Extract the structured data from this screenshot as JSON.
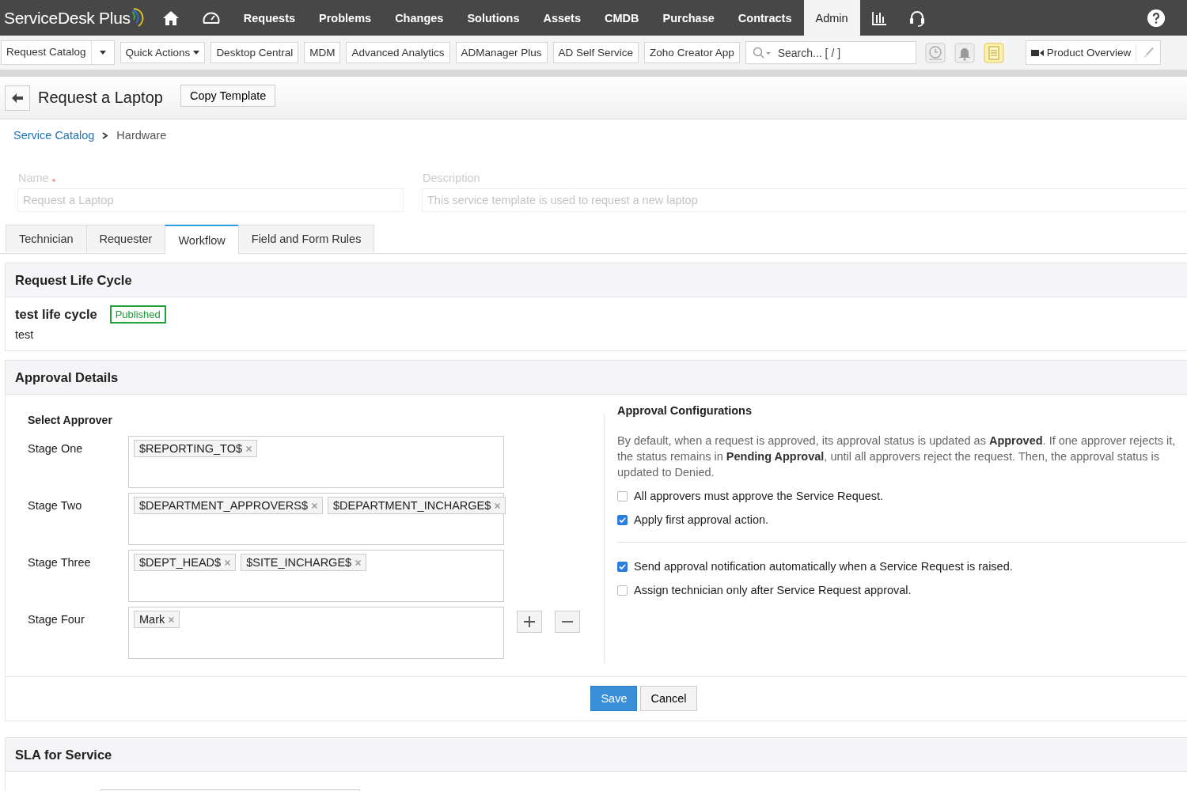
{
  "app": {
    "logo": "ServiceDesk Plus"
  },
  "nav": [
    {
      "kind": "icon",
      "selected": false
    },
    {
      "kind": "icon",
      "selected": false
    },
    {
      "kind": "text",
      "label": "Requests",
      "selected": false
    },
    {
      "kind": "text",
      "label": "Problems",
      "selected": false
    },
    {
      "kind": "text",
      "label": "Changes",
      "selected": false
    },
    {
      "kind": "text",
      "label": "Solutions",
      "selected": false
    },
    {
      "kind": "text",
      "label": "Assets",
      "selected": false
    },
    {
      "kind": "text",
      "label": "CMDB",
      "selected": false
    },
    {
      "kind": "text",
      "label": "Purchase",
      "selected": false
    },
    {
      "kind": "text",
      "label": "Contracts",
      "selected": false
    },
    {
      "kind": "text",
      "label": "Admin",
      "selected": true
    },
    {
      "kind": "icon",
      "selected": false
    },
    {
      "kind": "icon",
      "selected": false
    }
  ],
  "toolbar": [
    {
      "kind": "split",
      "label": "Request Catalog"
    },
    {
      "kind": "dropdown",
      "label": "Quick Actions"
    },
    {
      "kind": "plain",
      "label": "Desktop Central"
    },
    {
      "kind": "plain",
      "label": "MDM"
    },
    {
      "kind": "plain",
      "label": "Advanced Analytics"
    },
    {
      "kind": "plain",
      "label": "ADManager Plus"
    },
    {
      "kind": "plain",
      "label": "AD Self Service"
    },
    {
      "kind": "plain",
      "label": "Zoho Creator App"
    }
  ],
  "search": {
    "placeholder": "Search... [ / ]"
  },
  "product_overview": "Product Overview",
  "header": {
    "title": "Request a Laptop",
    "copy_button": "Copy Template"
  },
  "breadcrumb": [
    "Service Catalog",
    "Hardware"
  ],
  "form": {
    "name_label": "Name",
    "name_value": "Request a Laptop",
    "description_label": "Description",
    "description_value": "This service template is used to request a new laptop"
  },
  "tabs": [
    {
      "label": "Technician",
      "selected": false
    },
    {
      "label": "Requester",
      "selected": false
    },
    {
      "label": "Workflow",
      "selected": true
    },
    {
      "label": "Field and Form Rules",
      "selected": false
    }
  ],
  "life_cycle": {
    "heading": "Request Life Cycle",
    "name": "test life cycle",
    "status": "Published",
    "description": "test"
  },
  "approval": {
    "heading": "Approval Details",
    "select_label": "Select Approver",
    "stages": [
      {
        "label": "Stage One",
        "approvers": [
          "$REPORTING_TO$"
        ]
      },
      {
        "label": "Stage Two",
        "approvers": [
          "$DEPARTMENT_APPROVERS$",
          "$DEPARTMENT_INCHARGE$"
        ]
      },
      {
        "label": "Stage Three",
        "approvers": [
          "$DEPT_HEAD$",
          "$SITE_INCHARGE$"
        ]
      },
      {
        "label": "Stage Four",
        "approvers": [
          "Mark"
        ]
      }
    ],
    "config_heading": "Approval Configurations",
    "config_text": "By default, when a request is approved, its approval status is updated as **Approved**. If one approver rejects it, the status remains in **Pending Approval**, until all approvers reject the request. Then, the approval status is updated to Denied.",
    "options": [
      {
        "label": "All approvers must approve the Service Request.",
        "checked": false
      },
      {
        "label": "Apply first approval action.",
        "checked": true
      }
    ],
    "options_2": [
      {
        "label": "Send approval notification automatically when a Service Request is raised.",
        "checked": true
      },
      {
        "label": "Assign technician only after Service Request approval.",
        "checked": false
      }
    ],
    "save": "Save",
    "cancel": "Cancel"
  },
  "sla": {
    "heading": "SLA for Service"
  }
}
